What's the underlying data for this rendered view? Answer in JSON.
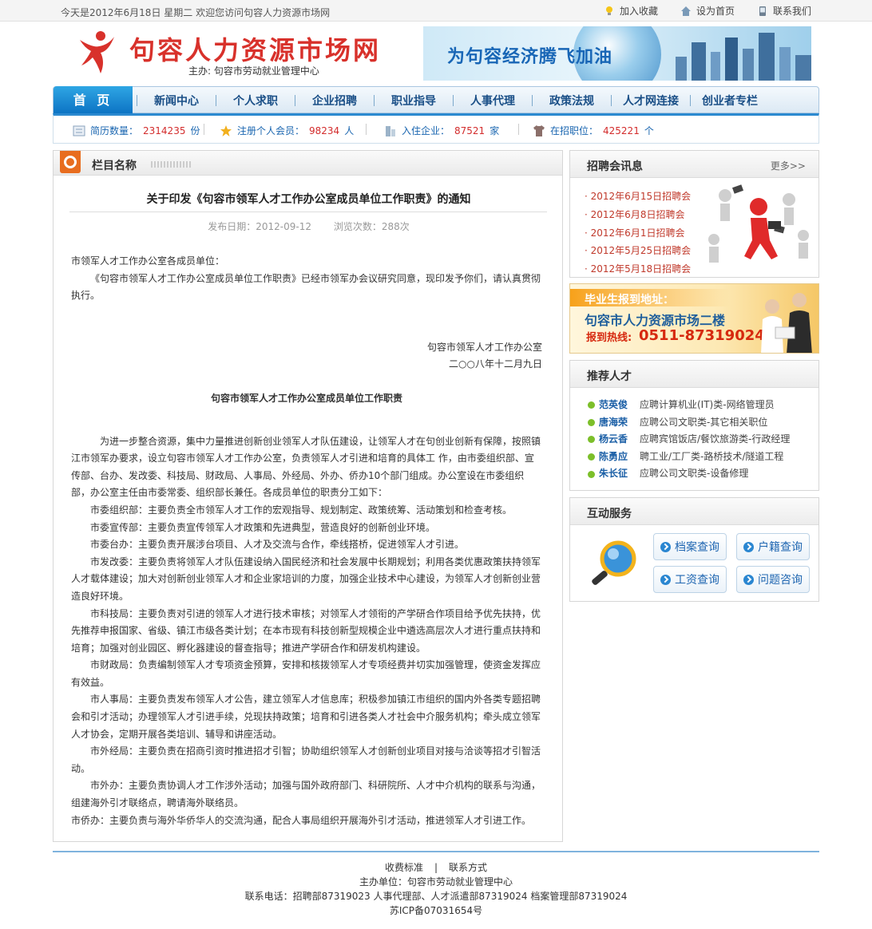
{
  "topbar": {
    "date_text": "今天是2012年6月18日 星期二   欢迎您访问句容人力资源市场网",
    "links": [
      "加入收藏",
      "设为首页",
      "联系我们"
    ]
  },
  "header": {
    "site_title": "句容人力资源市场网",
    "host": "主办: 句容市劳动就业管理中心",
    "banner_text": "为句容经济腾飞加油"
  },
  "nav": {
    "home": "首 页",
    "items": [
      "新闻中心",
      "个人求职",
      "企业招聘",
      "职业指导",
      "人事代理",
      "政策法规",
      "人才网连接",
      "创业者专栏"
    ]
  },
  "stats": [
    {
      "label": "简历数量：",
      "value": "2314235",
      "unit": "份"
    },
    {
      "label": "注册个人会员：",
      "value": "98234",
      "unit": "人"
    },
    {
      "label": "入住企业：",
      "value": "87521",
      "unit": "家"
    },
    {
      "label": "在招职位：",
      "value": "425221",
      "unit": "个"
    }
  ],
  "main": {
    "section_title": "栏目名称",
    "article_title": "关于印发《句容市领军人才工作办公室成员单位工作职责》的通知",
    "publish_date": "发布日期：2012-09-12",
    "views": "浏览次数：288次",
    "salutation": "市领军人才工作办公室各成员单位：",
    "intro": "《句容市领军人才工作办公室成员单位工作职责》已经市领军办会议研究同意，现印发予你们，请认真贯彻执行。",
    "signature_org": "句容市领军人才工作办公室",
    "signature_date": "二○○八年十二月九日",
    "doc_title": "句容市领军人才工作办公室成员单位工作职责",
    "doc_intro": "为进一步整合资源，集中力量推进创新创业领军人才队伍建设，让领军人才在句创业创新有保障，按照镇江市领军办要求，设立句容市领军人才工作办公室，负责领军人才引进和培育的具体工 作，由市委组织部、宣传部、台办、发改委、科技局、财政局、人事局、外经局、外办、侨办10个部门组成。办公室设在市委组织部，办公室主任由市委常委、组织部长兼任。各成员单位的职责分工如下：",
    "duties": [
      "市委组织部：主要负责全市领军人才工作的宏观指导、规划制定、政策统筹、活动策划和检查考核。",
      "市委宣传部：主要负责宣传领军人才政策和先进典型，营造良好的创新创业环境。",
      "市委台办：主要负责开展涉台项目、人才及交流与合作，牵线搭桥，促进领军人才引进。",
      "市发改委：主要负责将领军人才队伍建设纳入国民经济和社会发展中长期规划；利用各类优惠政策扶持领军人才载体建设；加大对创新创业领军人才和企业家培训的力度，加强企业技术中心建设，为领军人才创新创业营造良好环境。",
      "市科技局：主要负责对引进的领军人才进行技术审核；对领军人才领衔的产学研合作项目给予优先扶持，优先推荐申报国家、省级、镇江市级各类计划；在本市现有科技创新型规模企业中遴选高层次人才进行重点扶持和培育；加强对创业园区、孵化器建设的督查指导；推进产学研合作和研发机构建设。",
      "市财政局：负责编制领军人才专项资金预算，安排和核拨领军人才专项经费并切实加强管理，使资金发挥应有效益。",
      "市人事局：主要负责发布领军人才公告，建立领军人才信息库；积极参加镇江市组织的国内外各类专题招聘会和引才活动；办理领军人才引进手续，兑现扶持政策；培育和引进各类人才社会中介服务机构；牵头成立领军人才协会，定期开展各类培训、辅导和讲座活动。",
      "市外经局：主要负责在招商引资时推进招才引智；协助组织领军人才创新创业项目对接与洽谈等招才引智活动。",
      "市外办：主要负责协调人才工作涉外活动；加强与国外政府部门、科研院所、人才中介机构的联系与沟通，组建海外引才联络点，聘请海外联络员。"
    ],
    "last_duty": "市侨办：主要负责与海外华侨华人的交流沟通，配合人事局组织开展海外引才活动，推进领军人才引进工作。"
  },
  "sidebar": {
    "fair": {
      "title": "招聘会讯息",
      "more": "更多>>",
      "items": [
        "2012年6月15日招聘会",
        "2012年6月8日招聘会",
        "2012年6月1日招聘会",
        "2012年5月25日招聘会",
        "2012年5月18日招聘会"
      ]
    },
    "grad": {
      "line1": "毕业生报到地址：",
      "line2": "句容市人力资源市场二楼",
      "hotline_label": "报到热线:",
      "hotline": "0511-87319024"
    },
    "talent": {
      "title": "推荐人才",
      "items": [
        {
          "name": "范英俊",
          "job": "应聘计算机业(IT)类-网络管理员"
        },
        {
          "name": "唐海荣",
          "job": "应聘公司文职类-其它相关职位"
        },
        {
          "name": "杨云香",
          "job": "应聘宾馆饭店/餐饮旅游类-行政经理"
        },
        {
          "name": "陈勇应",
          "job": "聘工业/工厂类-路桥技术/隧道工程"
        },
        {
          "name": "朱长征",
          "job": "应聘公司文职类-设备修理"
        }
      ]
    },
    "service": {
      "title": "互动服务",
      "buttons": [
        "档案查询",
        "户籍查询",
        "工资查询",
        "问题咨询"
      ]
    }
  },
  "footer": {
    "link1": "收费标准",
    "divider": "|",
    "link2": "联系方式",
    "host": "主办单位：句容市劳动就业管理中心",
    "phones": "联系电话：招聘部87319023   人事代理部、人才派遣部87319024   档案管理部87319024",
    "icp": "苏ICP备07031654号"
  },
  "colors": {
    "brand_red": "#d8312b",
    "nav_blue": "#0b72c3",
    "link_blue": "#1a4f87",
    "stat_red": "#d32c2c"
  }
}
